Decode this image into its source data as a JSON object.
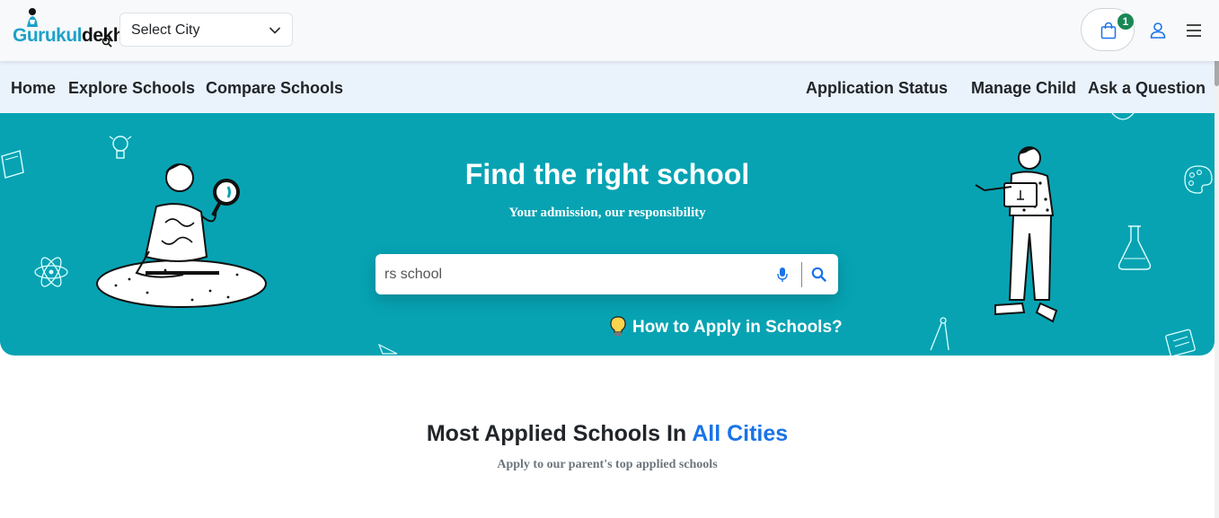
{
  "header": {
    "logo_text_a": "Gurukul",
    "logo_text_b": "dekho",
    "city_select": {
      "value": "Select City"
    },
    "cart_count": "1",
    "icons": {
      "cart": "shopping-bag-icon",
      "user": "user-icon",
      "menu": "hamburger-menu-icon",
      "chevron": "chevron-down-icon"
    }
  },
  "nav": {
    "home": "Home",
    "explore": "Explore Schools",
    "compare": "Compare Schools",
    "status": "Application Status",
    "manage": "Manage Child",
    "ask": "Ask a Question"
  },
  "hero": {
    "title": "Find the right school",
    "subtitle": "Your admission, our responsibility",
    "search": {
      "value": "rs school"
    },
    "how_to": "How to Apply in Schools?",
    "icons": {
      "mic": "microphone-icon",
      "search": "search-icon",
      "bulb": "lightbulb-icon"
    }
  },
  "section": {
    "title_prefix": "Most Applied Schools In ",
    "title_accent": "All Cities",
    "subtitle": "Apply to our parent's top applied schools"
  },
  "colors": {
    "hero_bg": "#07a3b3",
    "nav_bg": "#eaf2fb",
    "accent": "#1a73e8",
    "badge": "#198754"
  }
}
